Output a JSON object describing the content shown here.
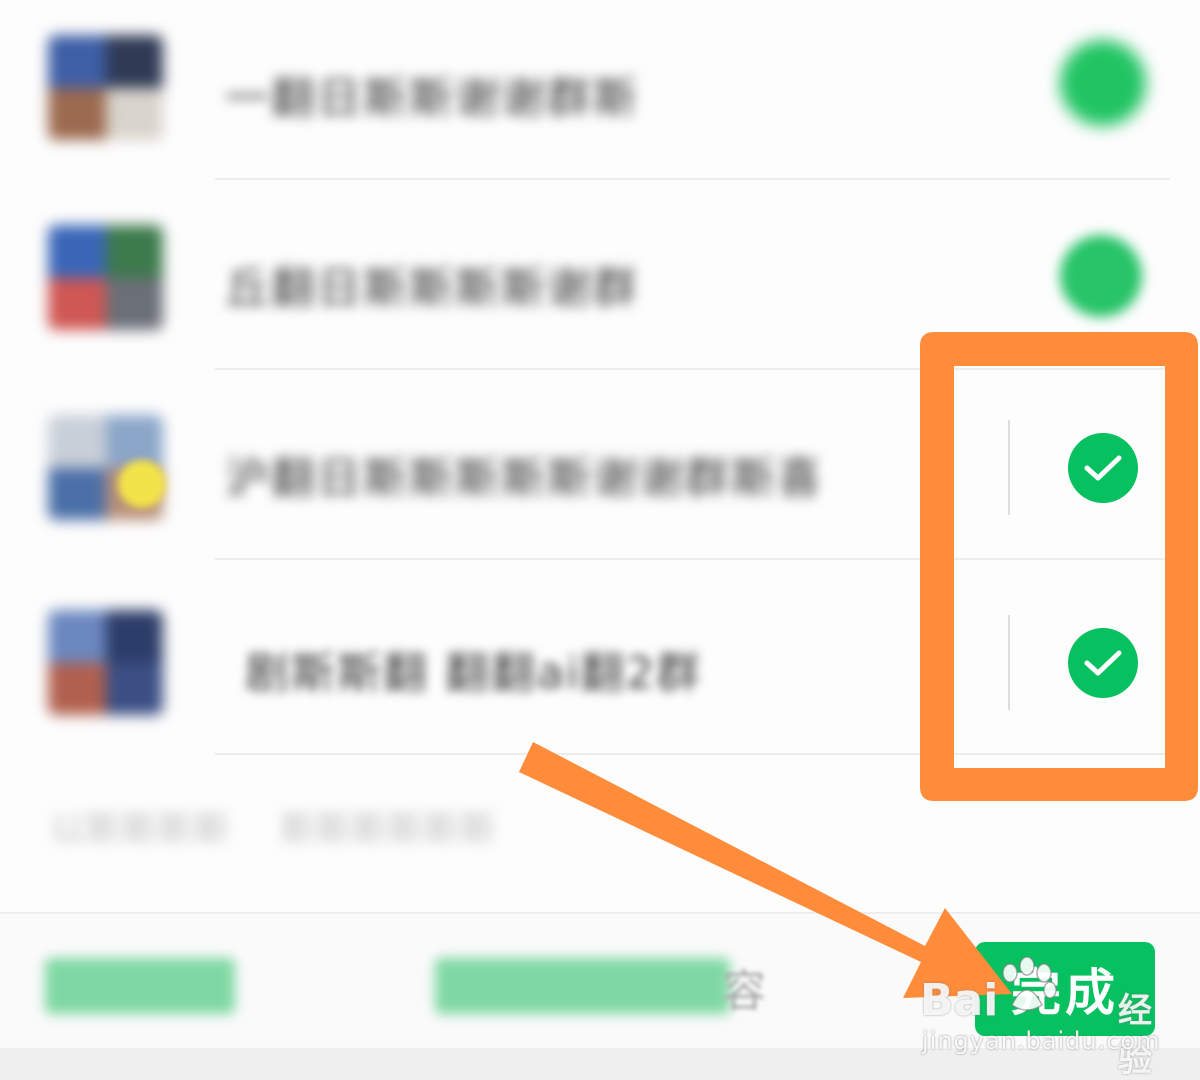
{
  "chats": [
    {
      "name": "一翻日斯斯谢谢群斯",
      "selected": true,
      "blurred": true,
      "avatar_colors": [
        "#3e5fa6",
        "#2f3a55",
        "#9c6a4f",
        "#d9d4cc"
      ]
    },
    {
      "name": "丘翻日斯斯斯斯谢群",
      "selected": true,
      "blurred": true,
      "avatar_colors": [
        "#3a66b8",
        "#3d7a4c",
        "#cf5754",
        "#6b6f78"
      ]
    },
    {
      "name": "沪翻日斯斯斯斯斯谢谢群斯喜",
      "selected": true,
      "blurred": false,
      "avatar_colors": [
        "#c9cfd8",
        "#8ba6c9",
        "#4b6fa8",
        "#b9907a"
      ]
    },
    {
      "name": "剧斯斯翻 翻翻ai翻2群",
      "selected": true,
      "blurred": false,
      "avatar_colors": [
        "#6b87bf",
        "#2d3d69",
        "#b1604e",
        "#3b4f85"
      ]
    }
  ],
  "muted_links": [
    "以斯斯斯斯",
    "斯斯斯斯斯斯"
  ],
  "bottom": {
    "action_tail": "容",
    "done_label": "完成"
  },
  "icons": {
    "check": "check-icon",
    "arrow": "orange-arrow",
    "paw": "baidu-paw-icon"
  },
  "colors": {
    "wechat_green": "#07c160",
    "annotation_orange": "#ff8c3a"
  },
  "watermark": {
    "brand": "Bai",
    "sub": "经验",
    "url": "jingyan.baidu.com"
  }
}
